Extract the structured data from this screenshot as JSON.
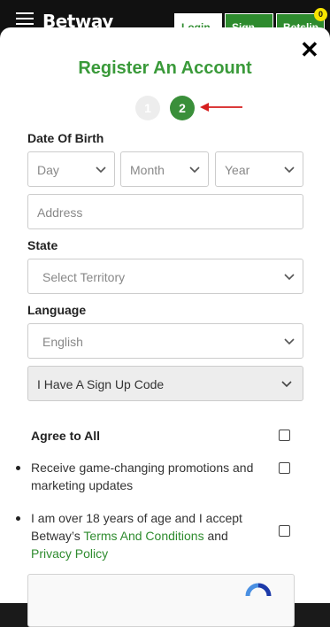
{
  "header": {
    "brand": "Betway",
    "login_label": "Login",
    "signup_label": "Sign Up",
    "betslip_label": "Betslip",
    "betslip_count": "0"
  },
  "modal": {
    "title": "Register An Account",
    "steps": [
      "1",
      "2"
    ],
    "active_step": 2
  },
  "form": {
    "dob_label": "Date Of Birth",
    "day_placeholder": "Day",
    "month_placeholder": "Month",
    "year_placeholder": "Year",
    "address_placeholder": "Address",
    "state_label": "State",
    "state_value": "Select Territory",
    "language_label": "Language",
    "language_value": "English",
    "signup_code_label": "I Have A Sign Up Code"
  },
  "agreements": {
    "agree_all": "Agree to All",
    "promotions": "Receive game-changing promotions and marketing updates",
    "age_text_1": "I am over 18 years of age and I accept Betway’s ",
    "terms_link": "Terms And Conditions",
    "age_text_2": " and ",
    "privacy_link": "Privacy Policy"
  },
  "colors": {
    "brand_green": "#3a9a3a",
    "step_active": "#3a8f3a",
    "arrow_red": "#d61f1f"
  }
}
